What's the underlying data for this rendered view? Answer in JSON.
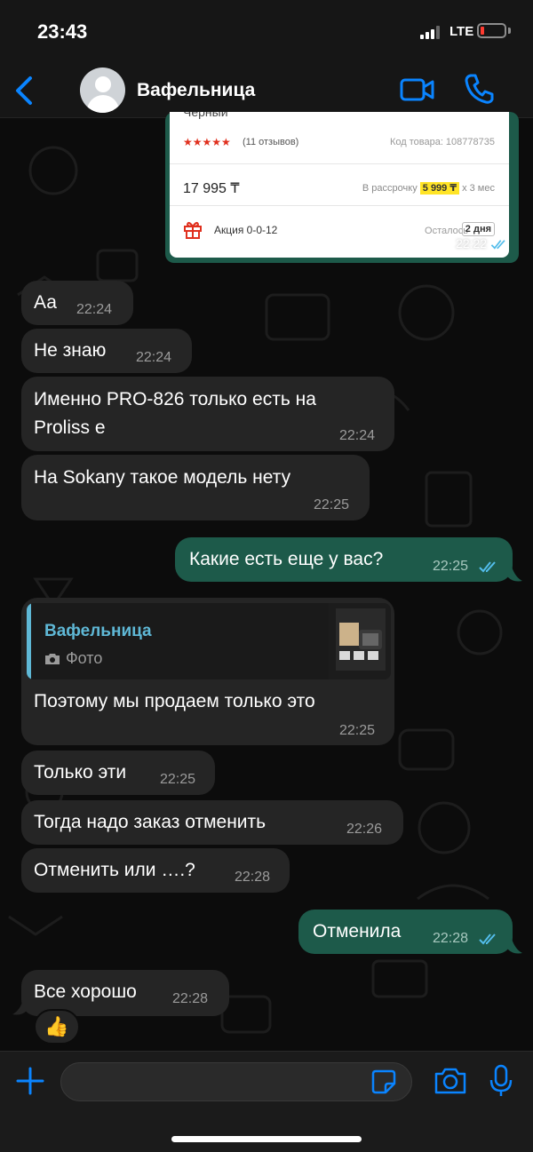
{
  "status_bar": {
    "time": "23:43",
    "network": "LTE",
    "battery_level": 0.1,
    "battery_color": "#ff3b30"
  },
  "header": {
    "back_icon": "chevron-left-icon",
    "title": "Вафельница",
    "video_icon": "video-call-icon",
    "phone_icon": "phone-icon",
    "accent_color": "#0a84ff"
  },
  "product_card": {
    "title_fragment": "Чёрный",
    "stars": "★★★★★",
    "reviews": "(11 отзывов)",
    "product_code": "Код товара: 108778735",
    "price": "17 995 ₸",
    "installment_prefix": "В рассрочку",
    "installment_amount": "5 999 ₸",
    "installment_suffix": "x 3 мес",
    "promo": "Акция 0-0-12",
    "remaining_label": "Осталось",
    "remaining_badge": "2 дня",
    "time": "22:22"
  },
  "messages": [
    {
      "direction": "in",
      "text": "Аа",
      "time": "22:24"
    },
    {
      "direction": "in",
      "text": "Не знаю",
      "time": "22:24"
    },
    {
      "direction": "in",
      "text_line1": "Именно PRO-826 только есть на",
      "text_line2": "Proliss е",
      "time": "22:24"
    },
    {
      "direction": "in",
      "text": "На Sokany такое модель нету",
      "time": "22:25"
    },
    {
      "direction": "out",
      "text": "Какие есть еще у вас?",
      "time": "22:25",
      "read": true
    },
    {
      "direction": "in",
      "quote_author": "Вафельница",
      "quote_type": "Фото",
      "text": "Поэтому мы продаем только это",
      "time": "22:25"
    },
    {
      "direction": "in",
      "text": "Только эти",
      "time": "22:25"
    },
    {
      "direction": "in",
      "text": "Тогда надо заказ отменить",
      "time": "22:26"
    },
    {
      "direction": "in",
      "text": "Отменить или ….?",
      "time": "22:28"
    },
    {
      "direction": "out",
      "text": "Отменила",
      "time": "22:28",
      "read": true
    },
    {
      "direction": "in",
      "text": "Все хорошо",
      "time": "22:28",
      "reaction": "👍"
    }
  ],
  "input_bar": {
    "plus_icon": "plus-icon",
    "placeholder": "",
    "sticker_icon": "sticker-icon",
    "camera_icon": "camera-icon",
    "mic_icon": "microphone-icon"
  },
  "colors": {
    "incoming_bubble": "#252525",
    "outgoing_bubble": "#1d5a4a",
    "read_ticks": "#53bdeb"
  }
}
